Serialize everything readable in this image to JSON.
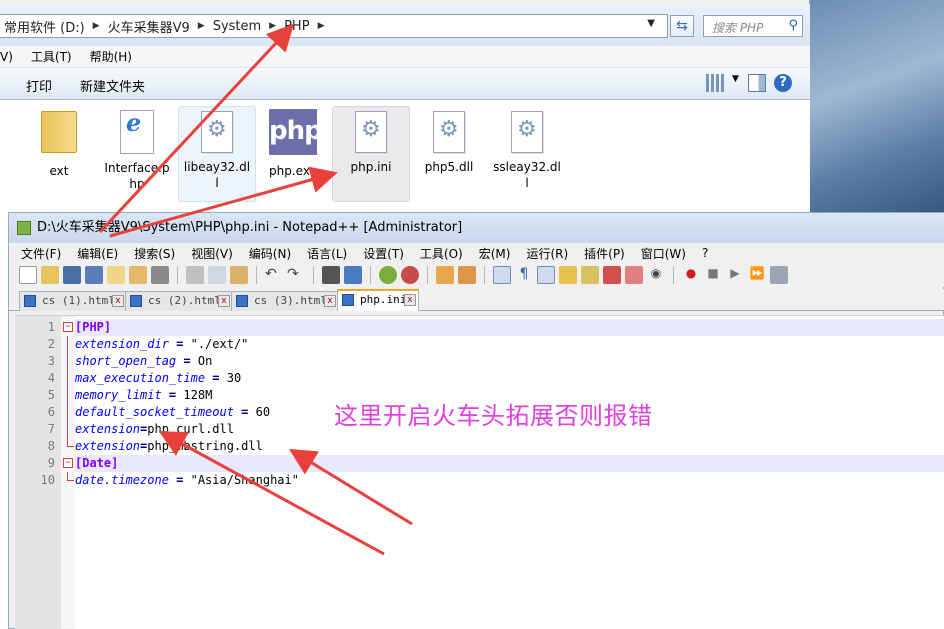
{
  "explorer": {
    "breadcrumb": [
      "常用软件 (D:)",
      "火车采集器V9",
      "System",
      "PHP"
    ],
    "search_placeholder": "搜索 PHP",
    "menu": [
      "V)",
      "工具(T)",
      "帮助(H)"
    ],
    "commands": {
      "print": "打印",
      "new_folder": "新建文件夹"
    },
    "files": [
      {
        "name": "ext",
        "icon": "folder-icon"
      },
      {
        "name": "Interface.php",
        "icon": "ie-file-icon"
      },
      {
        "name": "libeay32.dll",
        "icon": "dll-gear-icon"
      },
      {
        "name": "php.exe",
        "icon": "php-logo-icon"
      },
      {
        "name": "php.ini",
        "icon": "ini-gear-icon"
      },
      {
        "name": "php5.dll",
        "icon": "dll-gear-icon"
      },
      {
        "name": "ssleay32.dll",
        "icon": "dll-gear-icon"
      }
    ]
  },
  "npp": {
    "title": "D:\\火车采集器V9\\System\\PHP\\php.ini - Notepad++ [Administrator]",
    "menu": [
      "文件(F)",
      "编辑(E)",
      "搜索(S)",
      "视图(V)",
      "编码(N)",
      "语言(L)",
      "设置(T)",
      "工具(O)",
      "宏(M)",
      "运行(R)",
      "插件(P)",
      "窗口(W)",
      "?"
    ],
    "tabs": [
      "cs (1).html",
      "cs (2).html",
      "cs (3).html",
      "php.ini"
    ],
    "active_tab": "php.ini",
    "lines": [
      {
        "n": "1",
        "section": "[PHP]"
      },
      {
        "n": "2",
        "key": "extension_dir",
        "op": " = ",
        "val": "\"./ext/\""
      },
      {
        "n": "3",
        "key": "short_open_tag",
        "op": " = ",
        "val": "On"
      },
      {
        "n": "4",
        "key": "max_execution_time",
        "op": " = ",
        "val": "30"
      },
      {
        "n": "5",
        "key": "memory_limit",
        "op": " = ",
        "val": "128M"
      },
      {
        "n": "6",
        "key": "default_socket_timeout",
        "op": " = ",
        "val": "60"
      },
      {
        "n": "7",
        "key": "extension",
        "op": "=",
        "val": "php_curl.dll"
      },
      {
        "n": "8",
        "key": "extension",
        "op": "=",
        "val": "php_mbstring.dll"
      },
      {
        "n": "9",
        "section": "[Date]"
      },
      {
        "n": "10",
        "key": "date.timezone",
        "op": " = ",
        "val": "\"Asia/Shanghai\""
      }
    ]
  },
  "annotation": "这里开启火车头拓展否则报错",
  "colors": {
    "annotation": "#e040e0",
    "arrow": "#e8413b",
    "section": "#8000ff",
    "key": "#0000ff"
  }
}
